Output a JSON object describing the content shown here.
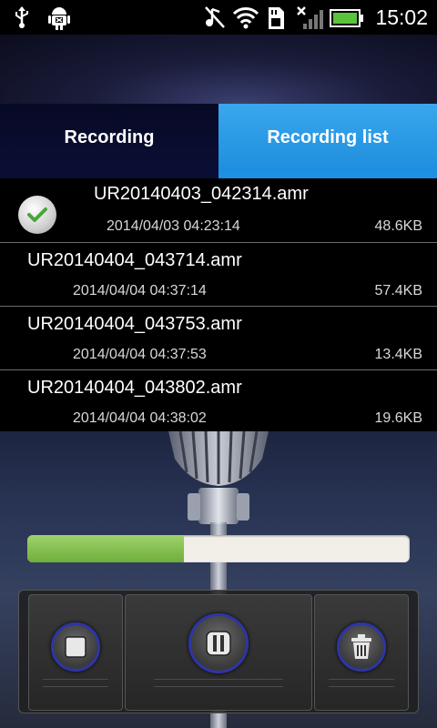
{
  "status_bar": {
    "time": "15:02",
    "icons": [
      "usb-icon",
      "android-debug-icon",
      "mute-icon",
      "wifi-icon",
      "sd-card-icon",
      "no-signal-icon",
      "battery-icon"
    ]
  },
  "tabs": [
    {
      "label": "Recording",
      "active": false
    },
    {
      "label": "Recording list",
      "active": true
    }
  ],
  "recordings": [
    {
      "name": "UR20140403_042314.amr",
      "date": "2014/04/03 04:23:14",
      "size": "48.6KB",
      "selected": true
    },
    {
      "name": "UR20140404_043714.amr",
      "date": "2014/04/04 04:37:14",
      "size": "57.4KB",
      "selected": false
    },
    {
      "name": "UR20140404_043753.amr",
      "date": "2014/04/04 04:37:53",
      "size": "13.4KB",
      "selected": false
    },
    {
      "name": "UR20140404_043802.amr",
      "date": "2014/04/04 04:38:02",
      "size": "19.6KB",
      "selected": false
    }
  ],
  "playback": {
    "progress_fraction": 0.41
  },
  "controls": {
    "stop_icon": "stop-icon",
    "pause_icon": "pause-icon",
    "delete_icon": "trash-icon"
  },
  "colors": {
    "tab_active": "#2a9ae8",
    "tab_inactive": "#0a0e35",
    "progress_fill": "#8bc45a",
    "button_ring": "#2d35a5"
  }
}
